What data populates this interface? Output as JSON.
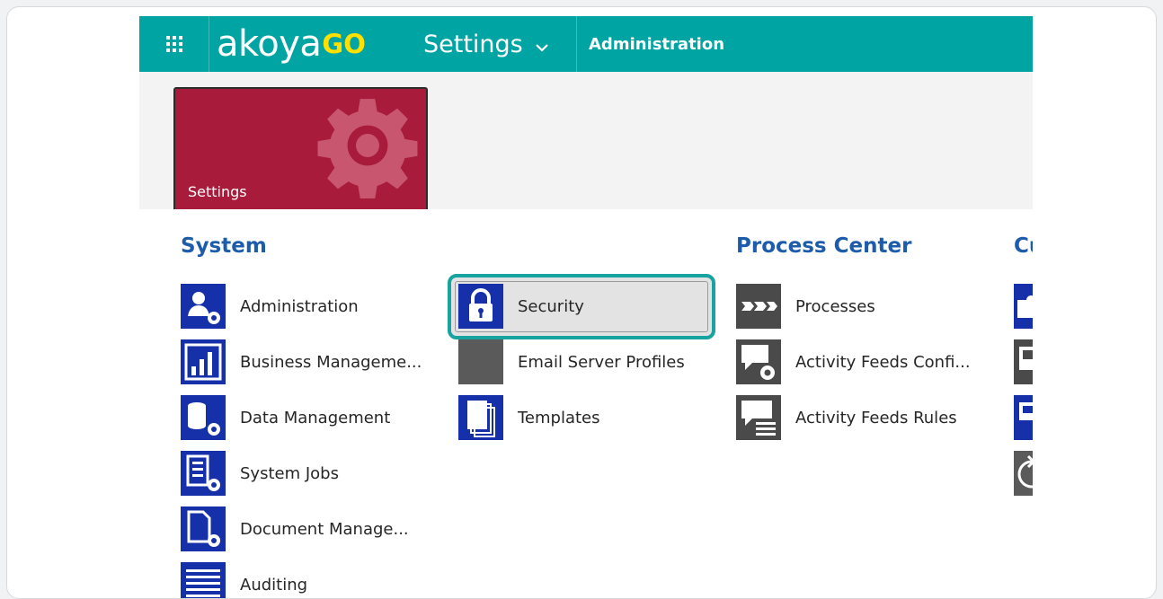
{
  "topbar": {
    "logo_main": "akoya",
    "logo_go": "GO",
    "nav_label": "Settings",
    "breadcrumb": "Administration",
    "bg_color": "#00a4a2"
  },
  "tile": {
    "label": "Settings",
    "color": "#a81b3a"
  },
  "groups": {
    "system": {
      "title": "System",
      "items": [
        {
          "label": "Administration",
          "icon": "admin-icon"
        },
        {
          "label": "Business Manageme...",
          "icon": "business-management-icon"
        },
        {
          "label": "Data Management",
          "icon": "data-management-icon"
        },
        {
          "label": "System Jobs",
          "icon": "system-jobs-icon"
        },
        {
          "label": "Document Manage...",
          "icon": "document-management-icon"
        },
        {
          "label": "Auditing",
          "icon": "auditing-icon"
        }
      ]
    },
    "system2": {
      "items": [
        {
          "label": "Security",
          "icon": "lock-icon"
        },
        {
          "label": "Email Server Profiles",
          "icon": "email-server-icon"
        },
        {
          "label": "Templates",
          "icon": "templates-icon"
        }
      ]
    },
    "process": {
      "title": "Process Center",
      "items": [
        {
          "label": "Processes",
          "icon": "processes-icon"
        },
        {
          "label": "Activity Feeds Confi...",
          "icon": "activity-feeds-config-icon"
        },
        {
          "label": "Activity Feeds Rules",
          "icon": "activity-feeds-rules-icon"
        }
      ]
    },
    "customization": {
      "title": "Cu"
    }
  }
}
